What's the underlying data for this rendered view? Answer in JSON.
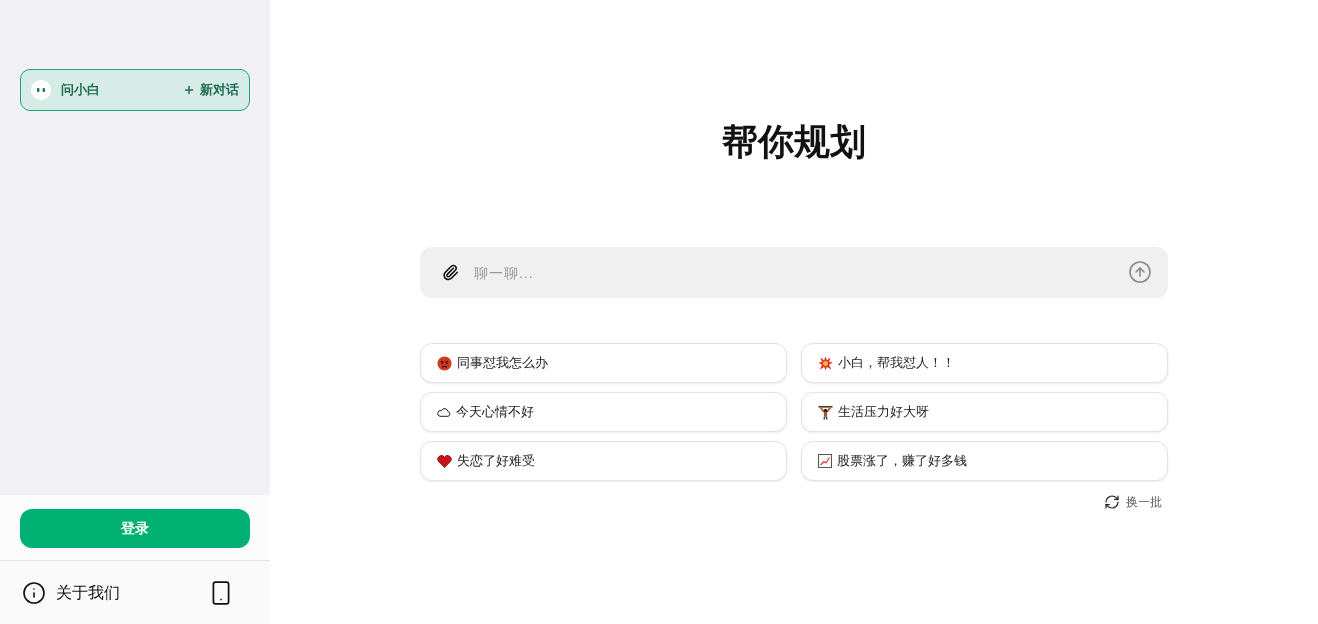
{
  "sidebar": {
    "assistant": {
      "name": "问小白",
      "new_chat": "新对话"
    },
    "login_button": "登录",
    "about": "关于我们"
  },
  "main": {
    "title": "帮你规划",
    "input": {
      "placeholder": "聊一聊..."
    },
    "suggestions": [
      {
        "text": "同事怼我怎么办"
      },
      {
        "text": "小白，帮我怼人！！"
      },
      {
        "text": "今天心情不好"
      },
      {
        "text": "生活压力好大呀"
      },
      {
        "text": "失恋了好难受"
      },
      {
        "text": "股票涨了，赚了好多钱"
      }
    ],
    "refresh": "换一批"
  }
}
